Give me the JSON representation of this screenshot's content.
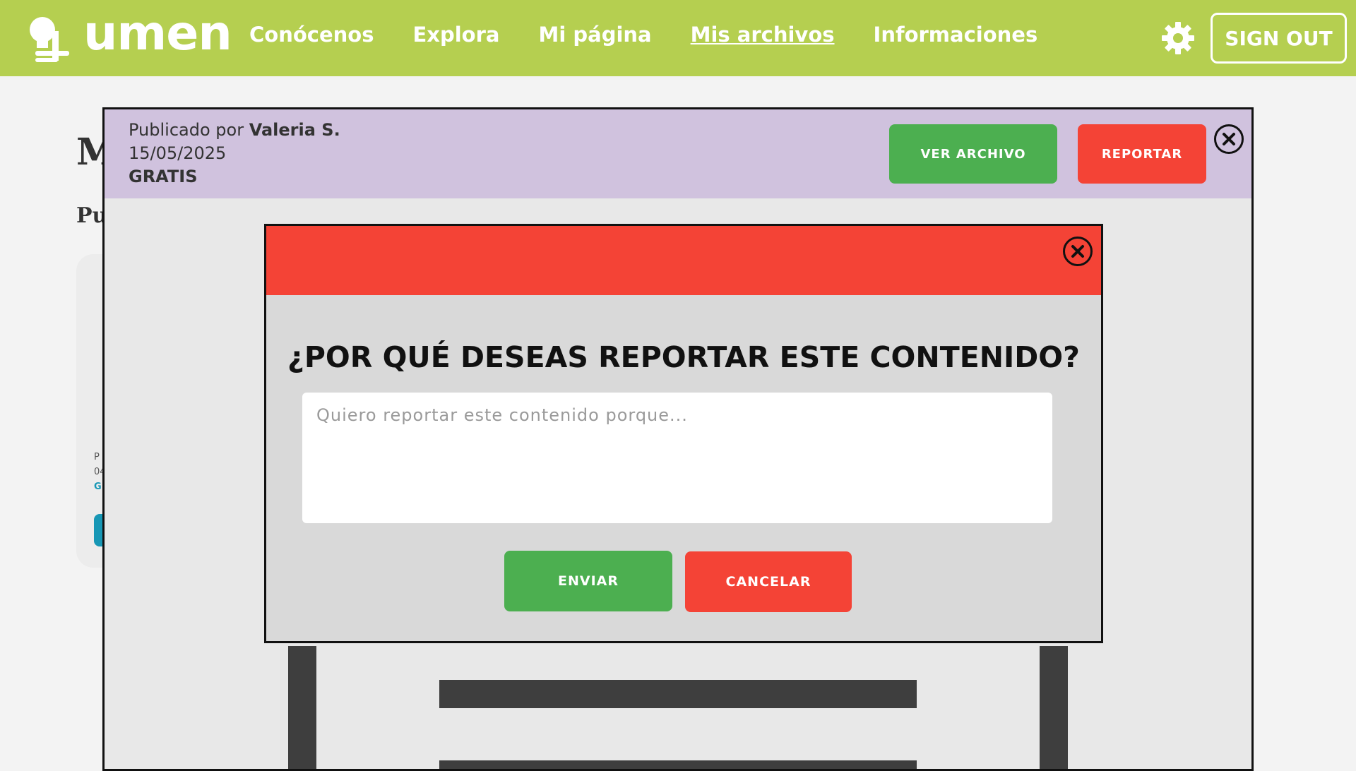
{
  "header": {
    "logo_text": "umen",
    "nav": [
      {
        "label": "Conócenos",
        "active": false
      },
      {
        "label": "Explora",
        "active": false
      },
      {
        "label": "Mi página",
        "active": false
      },
      {
        "label": "Mis archivos",
        "active": true
      },
      {
        "label": "Informaciones",
        "active": false
      }
    ],
    "settings_icon": "gear-icon",
    "signout_label": "SIGN OUT"
  },
  "background": {
    "heading_partial": "M",
    "sub_partial": "Pu",
    "card_lines": [
      "P",
      "04",
      "G"
    ]
  },
  "viewer": {
    "published_by_prefix": "Publicado por",
    "author": "Valeria S.",
    "date": "15/05/2025",
    "price": "GRATIS",
    "view_button": "VER ARCHIVO",
    "report_button": "REPORTAR",
    "close_icon": "close-icon"
  },
  "modal": {
    "title": "¿POR QUÉ DESEAS REPORTAR ESTE CONTENIDO?",
    "placeholder": "Quiero reportar este contenido porque...",
    "value": "",
    "send_button": "ENVIAR",
    "cancel_button": "CANCELAR",
    "close_icon": "close-icon"
  },
  "colors": {
    "header_bg": "#b5cf50",
    "viewer_bar_bg": "#d0c2de",
    "green": "#4caf50",
    "red": "#f44336"
  }
}
